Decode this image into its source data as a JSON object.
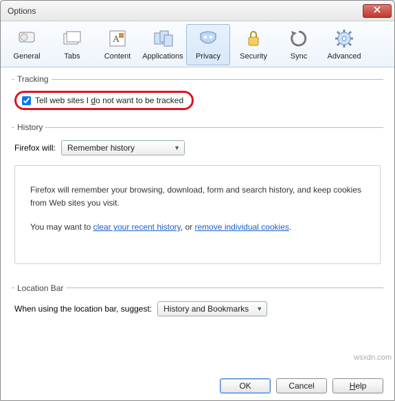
{
  "window": {
    "title": "Options"
  },
  "toolbar": {
    "items": [
      {
        "label": "General"
      },
      {
        "label": "Tabs"
      },
      {
        "label": "Content"
      },
      {
        "label": "Applications"
      },
      {
        "label": "Privacy"
      },
      {
        "label": "Security"
      },
      {
        "label": "Sync"
      },
      {
        "label": "Advanced"
      }
    ],
    "active_index": 4
  },
  "tracking": {
    "legend": "Tracking",
    "checkbox_checked": true,
    "label_before": "Tell web sites I ",
    "label_underline": "d",
    "label_after": "o not want to be tracked"
  },
  "history": {
    "legend": "History",
    "label": "Firefox will:",
    "selected": "Remember history",
    "info_line1": "Firefox will remember your browsing, download, form and search history, and keep cookies from Web sites you visit.",
    "info_prefix": "You may want to ",
    "link1": "clear your recent history",
    "info_mid": ", or ",
    "link2": "remove individual cookies",
    "info_suffix": "."
  },
  "location_bar": {
    "legend": "Location Bar",
    "label": "When using the location bar, suggest:",
    "selected": "History and Bookmarks"
  },
  "buttons": {
    "ok": "OK",
    "cancel": "Cancel",
    "help": "Help"
  },
  "watermark": "wsxdn.com"
}
